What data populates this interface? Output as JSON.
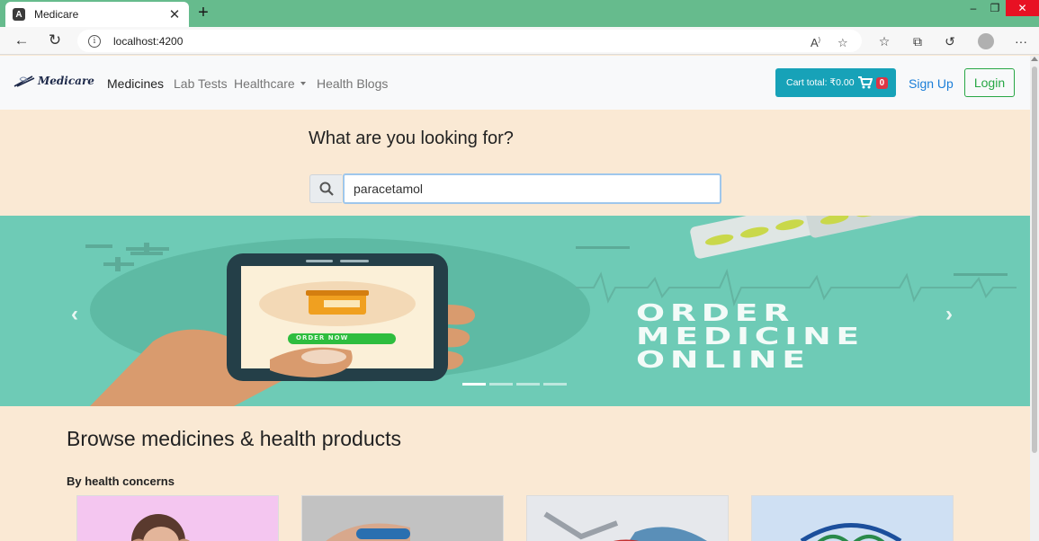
{
  "browser": {
    "tab_title": "Medicare",
    "favicon_letter": "A",
    "url": "localhost:4200"
  },
  "navbar": {
    "brand": "Medicare",
    "links": [
      "Medicines",
      "Lab Tests",
      "Healthcare",
      "Health Blogs"
    ],
    "cart_label": "Cart total: ₹0.00",
    "cart_count": "0",
    "signup": "Sign Up",
    "login": "Login"
  },
  "search": {
    "heading": "What are you looking for?",
    "value": "paracetamol"
  },
  "carousel": {
    "order_now": "ORDER NOW",
    "headline": [
      "ORDER",
      "MEDICINE",
      "ONLINE"
    ],
    "slide_count": 4,
    "active_slide": 1
  },
  "browse": {
    "heading": "Browse medicines & health products",
    "concerns_label": "By health concerns"
  },
  "colors": {
    "page_bg": "#fae9d4",
    "carousel_bg": "#6ecbb6",
    "cart_button": "#17a2b8",
    "badge": "#dc3545",
    "login_border": "#28a745",
    "tab_strip": "#66bb8d"
  }
}
